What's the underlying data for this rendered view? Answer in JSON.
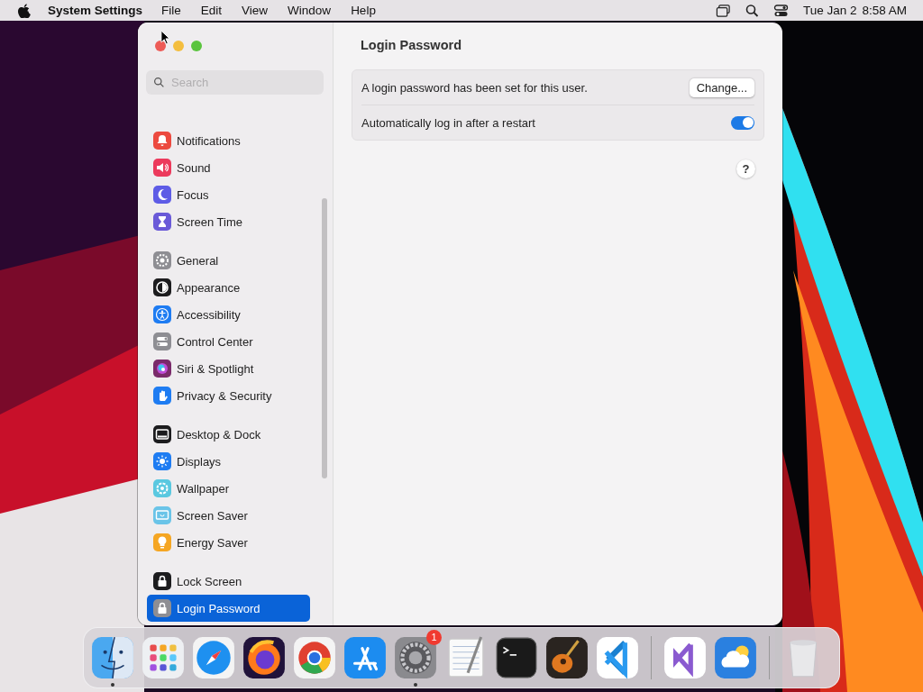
{
  "menu_bar": {
    "app_name": "System Settings",
    "menus": [
      "File",
      "Edit",
      "View",
      "Window",
      "Help"
    ],
    "date": "Tue Jan 2",
    "time": "8:58 AM"
  },
  "sidebar": {
    "search": {
      "placeholder": "Search"
    },
    "groups": [
      [
        {
          "label": "Notifications",
          "color": "#ec4a3f",
          "selected": false
        },
        {
          "label": "Sound",
          "color": "#ec3a5c",
          "selected": false
        },
        {
          "label": "Focus",
          "color": "#5e5ce6",
          "selected": false
        },
        {
          "label": "Screen Time",
          "color": "#6a5ad8",
          "selected": false
        }
      ],
      [
        {
          "label": "General",
          "color": "#8e8e93",
          "selected": false
        },
        {
          "label": "Appearance",
          "color": "#1c1c1e",
          "selected": false
        },
        {
          "label": "Accessibility",
          "color": "#1e7cf2",
          "selected": false
        },
        {
          "label": "Control Center",
          "color": "#8e8e93",
          "selected": false
        },
        {
          "label": "Siri & Spotlight",
          "color": "#7a2a6a",
          "selected": false
        },
        {
          "label": "Privacy & Security",
          "color": "#1e7cf2",
          "selected": false
        }
      ],
      [
        {
          "label": "Desktop & Dock",
          "color": "#1c1c1e",
          "selected": false
        },
        {
          "label": "Displays",
          "color": "#1e7cf2",
          "selected": false
        },
        {
          "label": "Wallpaper",
          "color": "#5ac8e0",
          "selected": false
        },
        {
          "label": "Screen Saver",
          "color": "#6ac4e8",
          "selected": false
        },
        {
          "label": "Energy Saver",
          "color": "#f5a623",
          "selected": false
        }
      ],
      [
        {
          "label": "Lock Screen",
          "color": "#1c1c1e",
          "selected": false
        },
        {
          "label": "Login Password",
          "color": "#8e8e93",
          "selected": true
        }
      ]
    ]
  },
  "content": {
    "title": "Login Password",
    "rows": [
      {
        "kind": "button",
        "label": "A login password has been set for this user.",
        "button": "Change..."
      },
      {
        "kind": "toggle",
        "label": "Automatically log in after a restart",
        "on": true
      }
    ],
    "help": "?"
  },
  "dock": {
    "groups": [
      [
        {
          "running": true
        },
        {
          "running": false
        },
        {
          "running": false
        },
        {
          "running": false
        },
        {
          "running": false
        },
        {
          "running": false
        },
        {
          "running": true,
          "badge": "1"
        },
        {
          "running": false
        },
        {
          "running": false
        },
        {
          "running": false
        },
        {
          "running": false
        }
      ],
      [
        {
          "running": false
        },
        {
          "running": false
        }
      ],
      [
        {
          "running": false
        }
      ]
    ]
  }
}
